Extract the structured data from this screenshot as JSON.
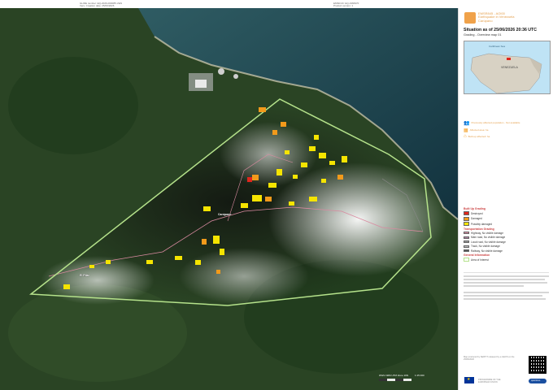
{
  "header": {
    "left_line1": "GLIDE number: EQ-2026-000085-VEN",
    "left_line2": "Vers. Creation date: 25/06/2026",
    "right_line1": "EMSR-ID: EQ-1966970",
    "right_line2": "Product version: 1"
  },
  "sidebar": {
    "title_orange": "EMSR845 - AOI00",
    "subtitle_orange": "Earthquake in Venezuela",
    "region_orange": "Carúpano",
    "situation": "Situation as of 25/06/2026 20:36 UTC",
    "map_type": "Grading - Overview map 01",
    "inset_country_label": "VENEZUELA",
    "inset_sea_label": "Caribbean Sea",
    "icons_caption_1": "Previously affected population - Not available",
    "icons_caption_2": "Affected area: ha",
    "icons_caption_3": "Built-up affected: ha",
    "legend": {
      "built_up_heading": "Built Up Grading",
      "destroyed": "Destroyed",
      "damaged": "Damaged",
      "possibly_damaged": "Possibly damaged",
      "transport_heading": "Transportation Grading",
      "highway": "Highway, No visible damage",
      "main_road": "Main road, No visible damage",
      "local_road": "Local road, No visible damage",
      "track": "Track, No visible damage",
      "railway": "Railway, No visible damage",
      "general_heading": "General Information",
      "area_of_interest": "Area of Interest"
    },
    "footer_text": "Map produced by SERTIT released by e-GEOS on the 25/06/2026",
    "footer_program": "PROGRAMME OF THE EUROPEAN UNION",
    "footer_copernicus": "opernicus"
  },
  "map": {
    "place_main": "Carúpano",
    "place_west": "El Pilar",
    "scale_text": "WGS 1984 UTM Zone 19N",
    "scale_ratio": "1:15 000"
  },
  "colors": {
    "destroyed": "#e0261d",
    "damaged": "#f29a1b",
    "possibly_damaged": "#f5e400",
    "aoi": "#b5e28b",
    "sea": "#1c3f4c",
    "land": "#263c22"
  }
}
